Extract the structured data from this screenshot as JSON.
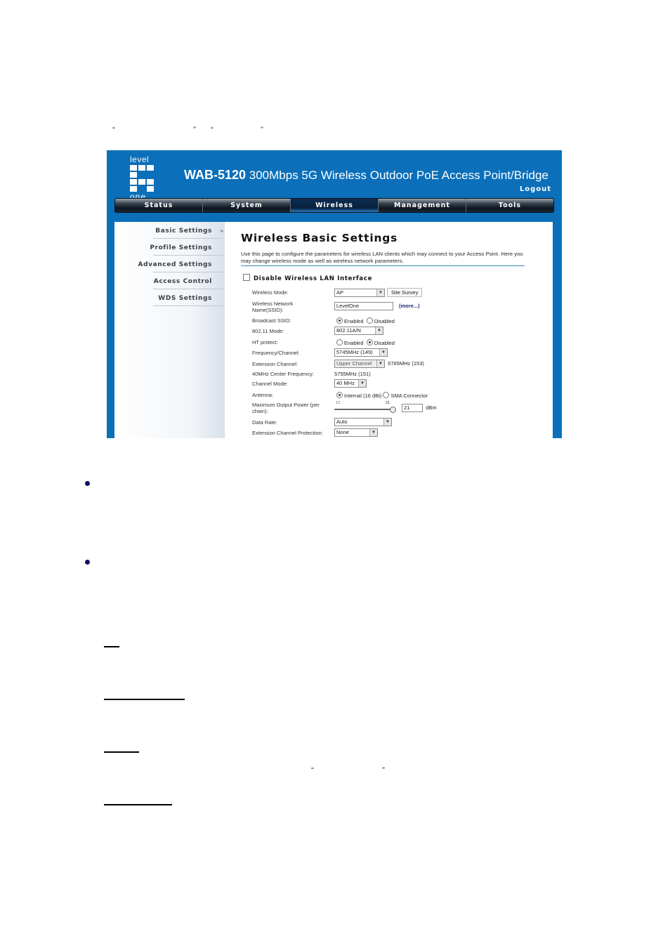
{
  "document": {
    "intro_quotes": [
      "“",
      "”",
      "“",
      "”"
    ],
    "inline_quotes": [
      "“",
      "”"
    ],
    "bullets": 2,
    "underlined_terms": 4
  },
  "screenshot": {
    "brand": {
      "logo_top": "level",
      "logo_bottom": "one",
      "model": "WAB-5120",
      "product_title": "300Mbps 5G Wireless Outdoor PoE Access Point/Bridge"
    },
    "logout_label": "Logout",
    "nav_tabs": [
      {
        "label": "Status",
        "active": false
      },
      {
        "label": "System",
        "active": false
      },
      {
        "label": "Wireless",
        "active": true
      },
      {
        "label": "Management",
        "active": false
      },
      {
        "label": "Tools",
        "active": false
      }
    ],
    "sidebar": {
      "items": [
        {
          "label": "Basic Settings",
          "active": true,
          "marker": "»"
        },
        {
          "label": "Profile Settings"
        },
        {
          "label": "Advanced Settings"
        },
        {
          "label": "Access Control"
        },
        {
          "label": "WDS Settings"
        }
      ]
    },
    "main": {
      "title": "Wireless Basic Settings",
      "description": "Use this page to configure the parameters for wireless LAN clients which may connect to your Access Point. Here you may change wireless mode as well as wireless network parameters.",
      "disable_wlan_label": "Disable Wireless LAN Interface",
      "disable_wlan_checked": false,
      "fields": {
        "wireless_mode": {
          "label": "Wireless Mode:",
          "value": "AP",
          "button": "Site Survey"
        },
        "ssid": {
          "label": "Wireless Network Name(SSID):",
          "value": "LevelOne",
          "link": "(more...)"
        },
        "broadcast_ssid": {
          "label": "Broadcast SSID:",
          "options": [
            "Enabled",
            "Disabled"
          ],
          "selected": "Enabled"
        },
        "mode_80211": {
          "label": "802.11 Mode:",
          "value": "802.11A/N"
        },
        "ht_protect": {
          "label": "HT protect:",
          "options": [
            "Enabled",
            "Disabled"
          ],
          "selected": "Disabled"
        },
        "freq_channel": {
          "label": "Frequency/Channel:",
          "value": "5745MHz (149)"
        },
        "ext_channel": {
          "label": "Extension Channel:",
          "value": "Upper Channel",
          "extra": "5765MHz (153)"
        },
        "center_freq": {
          "label": "40MHz Center Frequency:",
          "value": "5755MHz (151)"
        },
        "channel_mode": {
          "label": "Channel Mode:",
          "value": "40 MHz"
        },
        "antenna": {
          "label": "Antenna:",
          "options": [
            "Internal (16 dBi)",
            "SMA Connector"
          ],
          "selected": "Internal (16 dBi)"
        },
        "output_power": {
          "label": "Maximum Output Power (per chain):",
          "min": "12",
          "max": "21",
          "value": "21",
          "unit": "dBm",
          "slider_fraction": 1.0
        },
        "data_rate": {
          "label": "Data Rate:",
          "value": "Auto"
        },
        "ext_protection": {
          "label": "Extension Channel Protection:",
          "value": "None"
        }
      }
    }
  }
}
